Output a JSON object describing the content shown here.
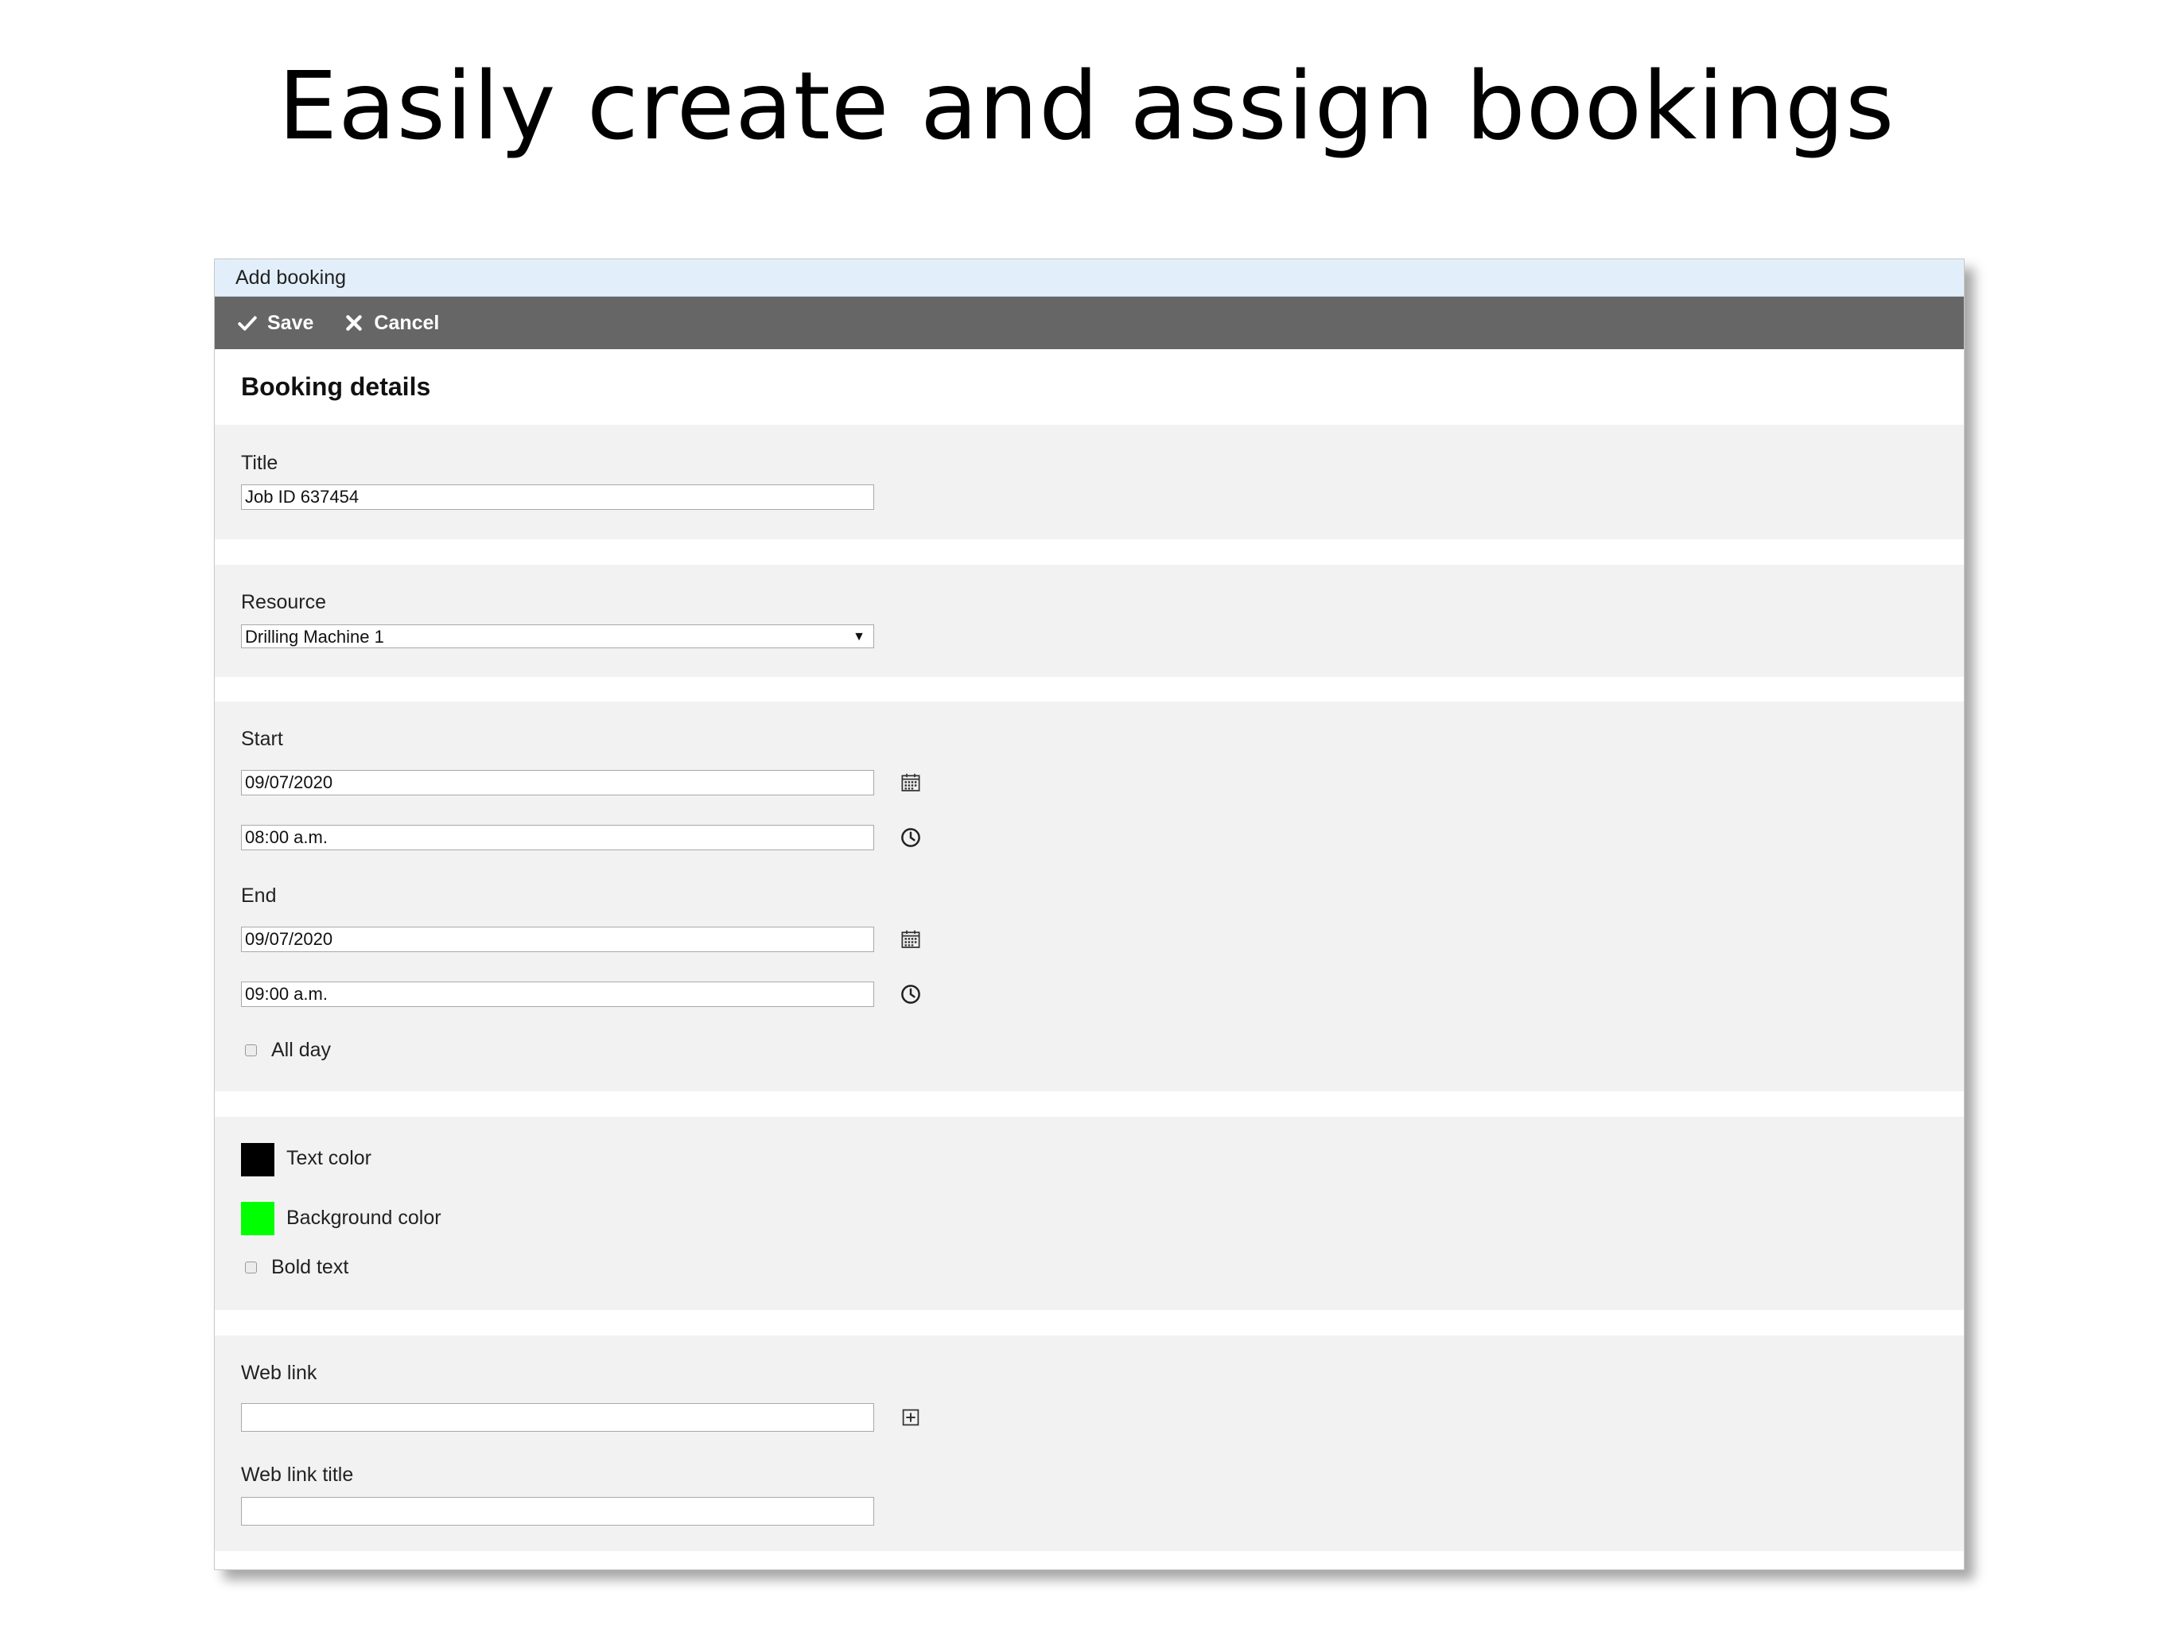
{
  "headline": "Easily create and assign bookings",
  "dialog": {
    "title": "Add booking",
    "toolbar": {
      "save_label": "Save",
      "cancel_label": "Cancel"
    },
    "heading": "Booking details",
    "title_field": {
      "label": "Title",
      "value": "Job ID 637454"
    },
    "resource": {
      "label": "Resource",
      "selected": "Drilling Machine 1"
    },
    "start": {
      "label": "Start",
      "date": "09/07/2020",
      "time": "08:00 a.m."
    },
    "end": {
      "label": "End",
      "date": "09/07/2020",
      "time": "09:00 a.m."
    },
    "all_day": {
      "label": "All day",
      "checked": false
    },
    "text_color": {
      "label": "Text color",
      "color": "#000000"
    },
    "background_color": {
      "label": "Background color",
      "color": "#00ff00"
    },
    "bold_text": {
      "label": "Bold text",
      "checked": false
    },
    "web_link": {
      "label": "Web link",
      "value": ""
    },
    "web_link_title": {
      "label": "Web link title",
      "value": ""
    }
  },
  "icons": {
    "save": "checkmark-icon",
    "cancel": "close-icon",
    "date": "calendar-icon",
    "time": "clock-icon",
    "add_link": "plus-square-icon"
  }
}
